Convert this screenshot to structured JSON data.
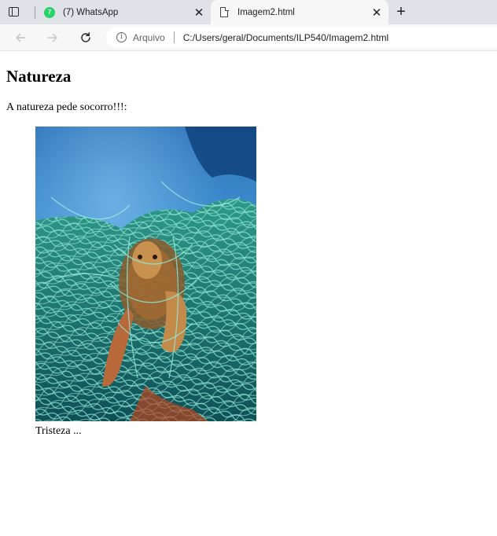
{
  "browser": {
    "tabs": [
      {
        "label": "(7) WhatsApp",
        "badge": "7",
        "close": "✕"
      },
      {
        "label": "Imagem2.html",
        "close": "✕"
      }
    ],
    "new_tab": "+",
    "omnibox": {
      "label": "Arquivo",
      "url": "C:/Users/geral/Documents/ILP540/Imagem2.html"
    },
    "icons": {
      "back": "arrow-left-icon",
      "forward": "arrow-right-icon",
      "reload": "reload-icon",
      "info": "info-icon",
      "file": "file-icon",
      "whatsapp": "whatsapp-icon",
      "tab_actions": "tab-actions-icon"
    }
  },
  "page": {
    "heading": "Natureza",
    "paragraph": "A natureza pede socorro!!!:",
    "figure": {
      "image": "sea turtle entangled in a green fishing net underwater",
      "caption": "Tristeza ..."
    }
  }
}
